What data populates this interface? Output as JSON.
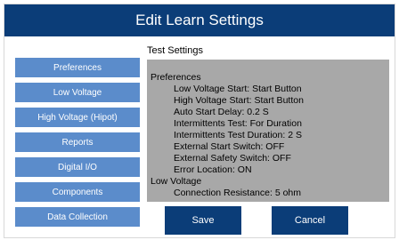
{
  "window": {
    "title": "Edit Learn Settings"
  },
  "sidebar": {
    "items": [
      {
        "label": "Preferences"
      },
      {
        "label": "Low Voltage"
      },
      {
        "label": "High Voltage (Hipot)"
      },
      {
        "label": "Reports"
      },
      {
        "label": "Digital I/O"
      },
      {
        "label": "Components"
      },
      {
        "label": "Data Collection"
      }
    ]
  },
  "main": {
    "section_title": "Test Settings",
    "settings": {
      "preferences": {
        "heading": "Preferences",
        "items": [
          "Low Voltage Start: Start Button",
          "High Voltage Start: Start Button",
          "Auto Start Delay: 0.2 S",
          "Intermittents Test: For Duration",
          "Intermittents Test Duration: 2 S",
          "External Start Switch: OFF",
          "External Safety Switch: OFF",
          "Error Location: ON"
        ]
      },
      "low_voltage": {
        "heading": "Low Voltage",
        "items": [
          "Connection Resistance: 5 ohm"
        ]
      }
    }
  },
  "actions": {
    "save_label": "Save",
    "cancel_label": "Cancel"
  },
  "colors": {
    "title_bar": "#0b3d78",
    "nav_button": "#5b8ccb",
    "settings_bg": "#a8a8a8"
  }
}
